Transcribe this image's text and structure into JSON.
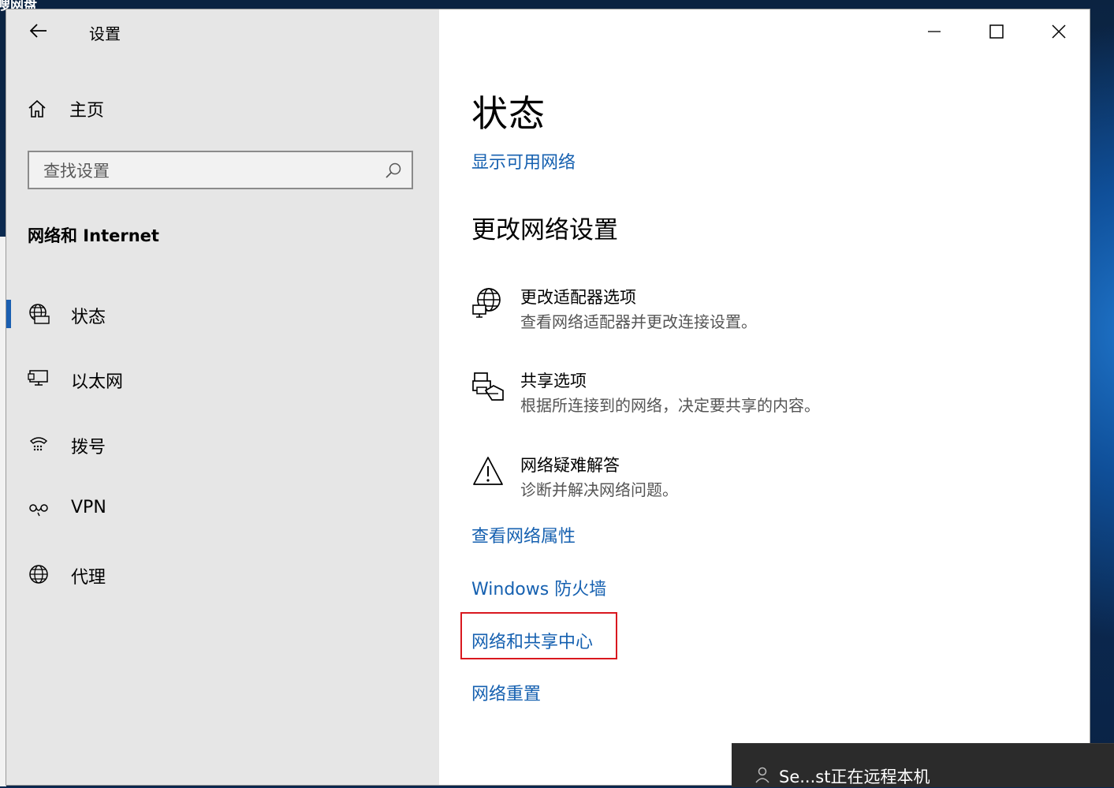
{
  "desktop": {
    "window_caption": "嗖网盘"
  },
  "window": {
    "title": "设置",
    "back_label": "",
    "controls": {
      "minimize": "minimize",
      "maximize": "maximize",
      "close": "close"
    }
  },
  "sidebar": {
    "home_label": "主页",
    "search_placeholder": "查找设置",
    "section_title": "网络和 Internet",
    "items": [
      {
        "label": "状态",
        "icon": "globe-monitor-icon",
        "active": true
      },
      {
        "label": "以太网",
        "icon": "ethernet-monitor-icon",
        "active": false
      },
      {
        "label": "拨号",
        "icon": "dialup-icon",
        "active": false
      },
      {
        "label": "VPN",
        "icon": "vpn-icon",
        "active": false
      },
      {
        "label": "代理",
        "icon": "globe-icon",
        "active": false
      }
    ]
  },
  "main": {
    "title": "状态",
    "show_networks_link": "显示可用网络",
    "change_settings_heading": "更改网络设置",
    "options": [
      {
        "title": "更改适配器选项",
        "desc": "查看网络适配器并更改连接设置。",
        "icon": "adapter-globe-icon"
      },
      {
        "title": "共享选项",
        "desc": "根据所连接到的网络，决定要共享的内容。",
        "icon": "sharing-printer-icon"
      },
      {
        "title": "网络疑难解答",
        "desc": "诊断并解决网络问题。",
        "icon": "warning-icon"
      }
    ],
    "links": {
      "properties": "查看网络属性",
      "firewall": "Windows 防火墙",
      "sharing_center": "网络和共享中心",
      "reset": "网络重置"
    }
  },
  "notification": {
    "text": "Se...st正在远程本机",
    "icon": "user-icon"
  },
  "colors": {
    "link": "#1560b0",
    "highlight": "#d9181f",
    "sidebar_bg": "#e6e6e6",
    "accent": "#1b5fb1"
  }
}
